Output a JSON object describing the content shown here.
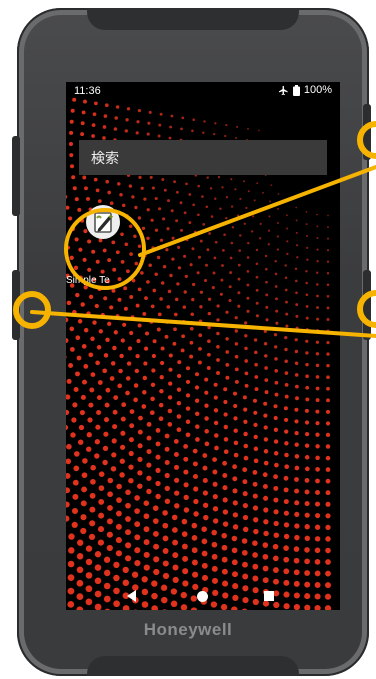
{
  "status_bar": {
    "time": "11:36",
    "battery": "100%"
  },
  "search": {
    "placeholder": "検索"
  },
  "apps": [
    {
      "label": "Simple Te",
      "icon": "pencil-document-icon"
    }
  ],
  "nav": {
    "back_icon": "back-triangle-icon",
    "home_icon": "home-circle-icon",
    "recents_icon": "recents-square-icon"
  },
  "device": {
    "brand": "Honeywell"
  },
  "colors": {
    "callout": "#f6b400",
    "wallpaper_dot": "#e0321c",
    "device_body": "#3d3e40"
  }
}
